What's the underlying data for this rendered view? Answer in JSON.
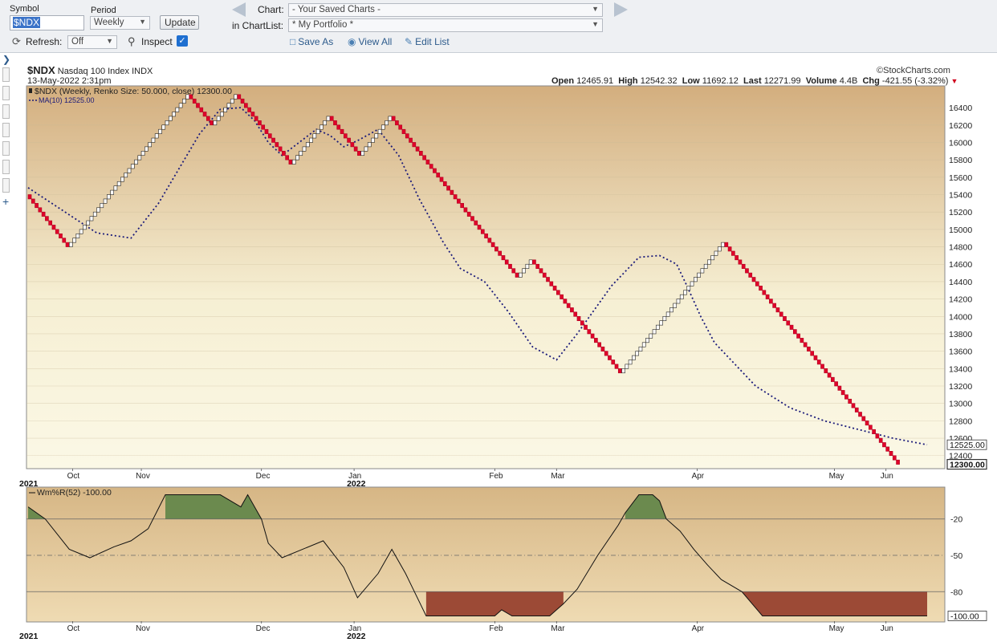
{
  "toolbar": {
    "symbol_label": "Symbol",
    "symbol_value": "$NDX",
    "period_label": "Period",
    "period_value": "Weekly",
    "update_label": "Update",
    "refresh_label": "Refresh:",
    "refresh_value": "Off",
    "inspect_label": "Inspect",
    "inspect_checked": true,
    "chart_label": "Chart:",
    "chart_value": "- Your Saved Charts -",
    "chartlist_label": "in ChartList:",
    "chartlist_value": "* My Portfolio *",
    "save_as": "Save As",
    "view_all": "View All",
    "edit_list": "Edit List"
  },
  "header": {
    "symbol": "$NDX",
    "name": "Nasdaq 100 Index",
    "exchange": "INDX",
    "date": "13-May-2022 2:31pm",
    "brand": "©StockCharts.com",
    "open_label": "Open",
    "open": "12465.91",
    "high_label": "High",
    "high": "12542.32",
    "low_label": "Low",
    "low": "11692.12",
    "last_label": "Last",
    "last": "12271.99",
    "volume_label": "Volume",
    "volume": "4.4B",
    "chg_label": "Chg",
    "chg": "-421.55 (-3.32%)"
  },
  "colors": {
    "up_brick_fill": "#ffffff",
    "down_brick_fill": "#e0002a",
    "ma_line": "#1a1a7a",
    "panel_top": "#d3ae7e",
    "panel_mid": "#f6efd3",
    "panel_bottom": "#fbf8e6",
    "overbought_fill": "#6b8a4e",
    "oversold_fill": "#9c4a36"
  },
  "chart_data": [
    {
      "type": "renko",
      "title": "$NDX (Weekly, Renko Size: 50.000, close) 12300.00",
      "box_size": 50,
      "series": [
        {
          "name": "$NDX (Weekly, Renko Size: 50.000, close)",
          "brick_path": [
            15400,
            14800,
            16550,
            16200,
            16550,
            15750,
            16300,
            15850,
            16300,
            14450,
            14650,
            13350,
            14850,
            12300
          ]
        },
        {
          "name": "MA(10) 12525.00",
          "x": [
            0,
            10,
            20,
            30,
            38,
            44,
            50,
            56,
            62,
            66,
            70,
            74,
            79,
            84,
            88,
            92,
            96,
            102,
            108,
            114,
            121,
            126,
            133,
            140,
            147,
            154,
            160,
            170,
            178,
            184,
            189,
            192,
            196,
            200,
            212,
            222,
            232,
            242,
            252,
            262
          ],
          "y": [
            15480,
            15220,
            14960,
            14900,
            15300,
            15700,
            16100,
            16380,
            16400,
            16250,
            16000,
            15850,
            16000,
            16150,
            16080,
            15950,
            16020,
            16150,
            15850,
            15350,
            14850,
            14550,
            14400,
            14050,
            13650,
            13500,
            13800,
            14350,
            14680,
            14700,
            14600,
            14350,
            14000,
            13700,
            13200,
            12950,
            12800,
            12700,
            12600,
            12525
          ]
        }
      ],
      "last_value_labels": [
        "12525.00",
        "12300.00"
      ],
      "y_ticks": [
        12400,
        12600,
        12800,
        13000,
        13200,
        13400,
        13600,
        13800,
        14000,
        14200,
        14400,
        14600,
        14800,
        15000,
        15200,
        15400,
        15600,
        15800,
        16000,
        16200,
        16400
      ],
      "x_ticks": [
        {
          "label": "Oct",
          "x": 13
        },
        {
          "label": "Nov",
          "x": 33
        },
        {
          "label": "Dec",
          "x": 68
        },
        {
          "label": "Jan",
          "x": 95
        },
        {
          "label": "Feb",
          "x": 136
        },
        {
          "label": "Mar",
          "x": 154
        },
        {
          "label": "Apr",
          "x": 195
        },
        {
          "label": "May",
          "x": 235
        },
        {
          "label": "Jun",
          "x": 250
        }
      ],
      "year_labels": [
        {
          "label": "2021",
          "x": 0
        },
        {
          "label": "2022",
          "x": 95
        }
      ],
      "ylim": [
        12250,
        16650
      ],
      "xlim": [
        0,
        262
      ],
      "grid": true
    },
    {
      "type": "line",
      "title": "Wm%R(52) -100.00",
      "x": [
        0,
        5,
        12,
        18,
        25,
        30,
        35,
        40,
        45,
        50,
        56,
        62,
        64,
        68,
        70,
        74,
        80,
        86,
        92,
        96,
        102,
        106,
        110,
        116,
        121,
        126,
        132,
        136,
        138,
        141,
        144,
        147,
        152,
        156,
        160,
        166,
        172,
        174,
        178,
        182,
        184,
        186,
        190,
        194,
        198,
        202,
        208,
        214,
        220,
        224,
        228,
        232,
        240,
        250,
        262
      ],
      "y": [
        -10,
        -20,
        -45,
        -52,
        -43,
        -38,
        -28,
        0,
        0,
        0,
        0,
        -10,
        0,
        -20,
        -40,
        -52,
        -45,
        -38,
        -60,
        -85,
        -65,
        -45,
        -65,
        -100,
        -100,
        -100,
        -100,
        -100,
        -95,
        -100,
        -100,
        -100,
        -100,
        -90,
        -78,
        -50,
        -25,
        -15,
        0,
        0,
        -5,
        -20,
        -30,
        -45,
        -58,
        -70,
        -80,
        -100,
        -100,
        -100,
        -100,
        -100,
        -100,
        -100,
        -100
      ],
      "y_ticks": [
        -20,
        -50,
        -80
      ],
      "overbought": -20,
      "oversold": -80,
      "last_value_label": "-100.00",
      "ylim": [
        -105,
        5
      ]
    }
  ]
}
